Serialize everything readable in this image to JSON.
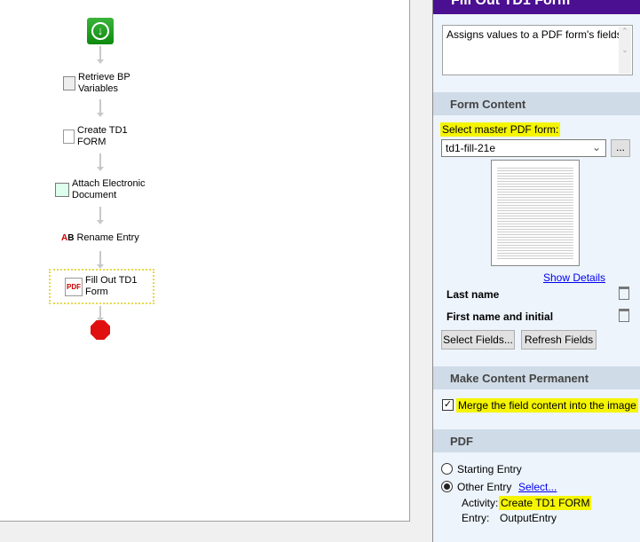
{
  "workflow": {
    "nodes": [
      "Retrieve BP Variables",
      "Create TD1 FORM",
      "Attach Electronic Document",
      "Rename Entry",
      "Fill Out TD1 Form"
    ]
  },
  "panel": {
    "title": "Fill Out TD1 Form",
    "description": "Assigns values to a PDF form's fields.",
    "form_content": {
      "header": "Form Content",
      "select_label": "Select master PDF form:",
      "selected_form": "td1-fill-21e",
      "browse": "...",
      "show_details": "Show Details",
      "fields": [
        "Last name",
        "First name and initial"
      ],
      "select_fields": "Select Fields...",
      "refresh_fields": "Refresh Fields"
    },
    "permanent": {
      "header": "Make Content Permanent",
      "merge_label": "Merge the field content into the image",
      "merge_checked": true
    },
    "pdf": {
      "header": "PDF",
      "starting_entry": "Starting Entry",
      "other_entry": "Other Entry",
      "select_link": "Select...",
      "activity_label": "Activity:",
      "activity_value": "Create TD1 FORM",
      "entry_label": "Entry:",
      "entry_value": "OutputEntry"
    }
  }
}
